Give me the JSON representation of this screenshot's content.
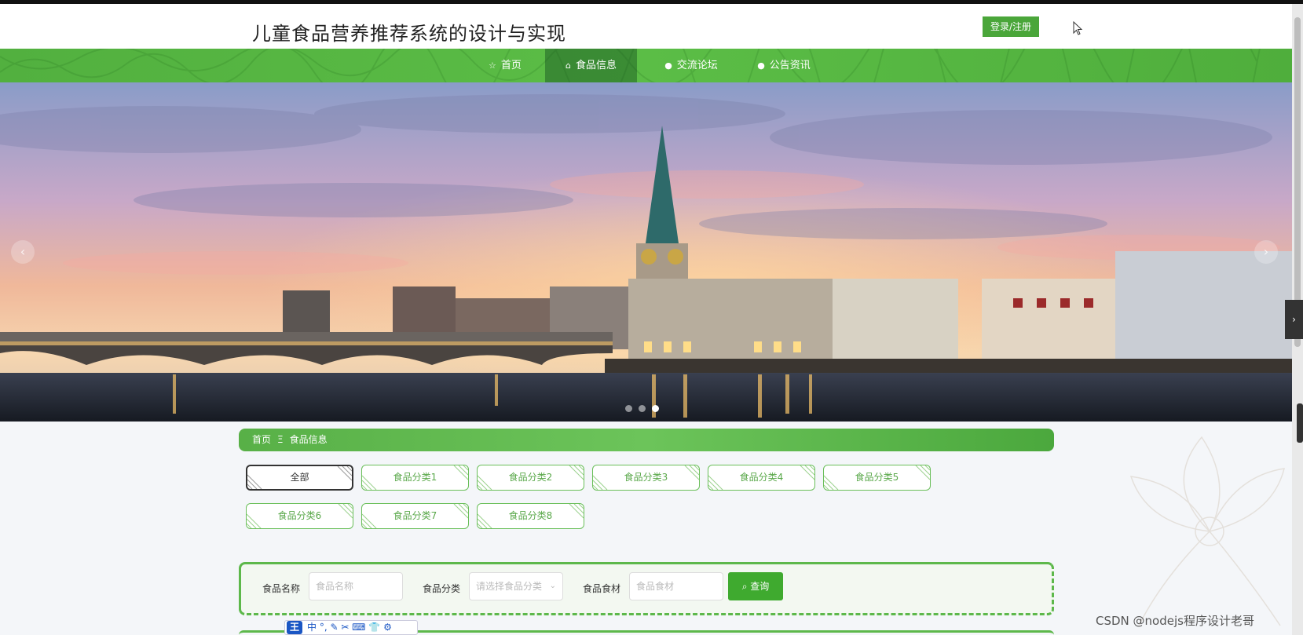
{
  "header": {
    "title": "儿童食品营养推荐系统的设计与实现",
    "login_label": "登录/注册"
  },
  "nav": {
    "items": [
      {
        "label": "首页",
        "icon": "star-icon"
      },
      {
        "label": "食品信息",
        "icon": "bag-icon"
      },
      {
        "label": "交流论坛",
        "icon": "info-icon"
      },
      {
        "label": "公告资讯",
        "icon": "question-icon"
      }
    ],
    "active": "食品信息"
  },
  "banner": {
    "prev_label": "‹",
    "next_label": "›",
    "slides": 3,
    "active_slide": 3
  },
  "breadcrumb": {
    "home": "首页",
    "separator": "Ξ",
    "current": "食品信息"
  },
  "categories": {
    "items": [
      "全部",
      "食品分类1",
      "食品分类2",
      "食品分类3",
      "食品分类4",
      "食品分类5",
      "食品分类6",
      "食品分类7",
      "食品分类8"
    ],
    "active": "全部"
  },
  "search": {
    "name_label": "食品名称",
    "name_placeholder": "食品名称",
    "category_label": "食品分类",
    "category_placeholder": "请选择食品分类",
    "ingredient_label": "食品食材",
    "ingredient_placeholder": "食品食材",
    "query_label": "查询"
  },
  "ime": {
    "logo": "王",
    "tools": "中 °, ✎ ✂ ⌨ 👕 ⚙"
  },
  "watermark": "CSDN @nodejs程序设计老哥",
  "colors": {
    "accent": "#4aa63a",
    "nav_bg": "#56b442",
    "breadcrumb_bg": "#5cb64a"
  }
}
